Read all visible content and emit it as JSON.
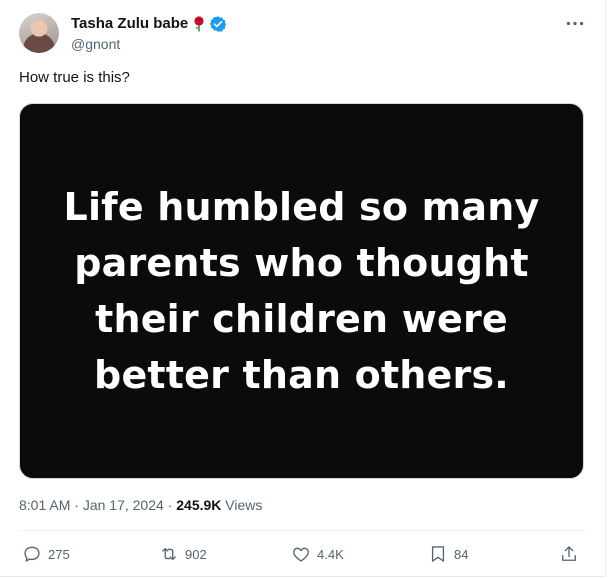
{
  "author": {
    "display_name": "Tasha Zulu babe",
    "handle": "@gnont",
    "emoji": "rose",
    "verified": true
  },
  "tweet": {
    "text": "How true is this?",
    "image_text": "Life humbled so many parents who thought their children were better than others."
  },
  "meta": {
    "time": "8:01 AM",
    "separator": "·",
    "date": "Jan 17, 2024",
    "views_count": "245.9K",
    "views_label": "Views"
  },
  "actions": {
    "replies": "275",
    "reposts": "902",
    "likes": "4.4K",
    "bookmarks": "84"
  },
  "icons": [
    "more-icon",
    "verified-badge-icon",
    "rose-icon",
    "reply-icon",
    "repost-icon",
    "like-icon",
    "bookmark-icon",
    "share-icon"
  ],
  "colors": {
    "verified": "#1d9bf0",
    "secondary_text": "#536471",
    "rose": "#c8102e"
  }
}
